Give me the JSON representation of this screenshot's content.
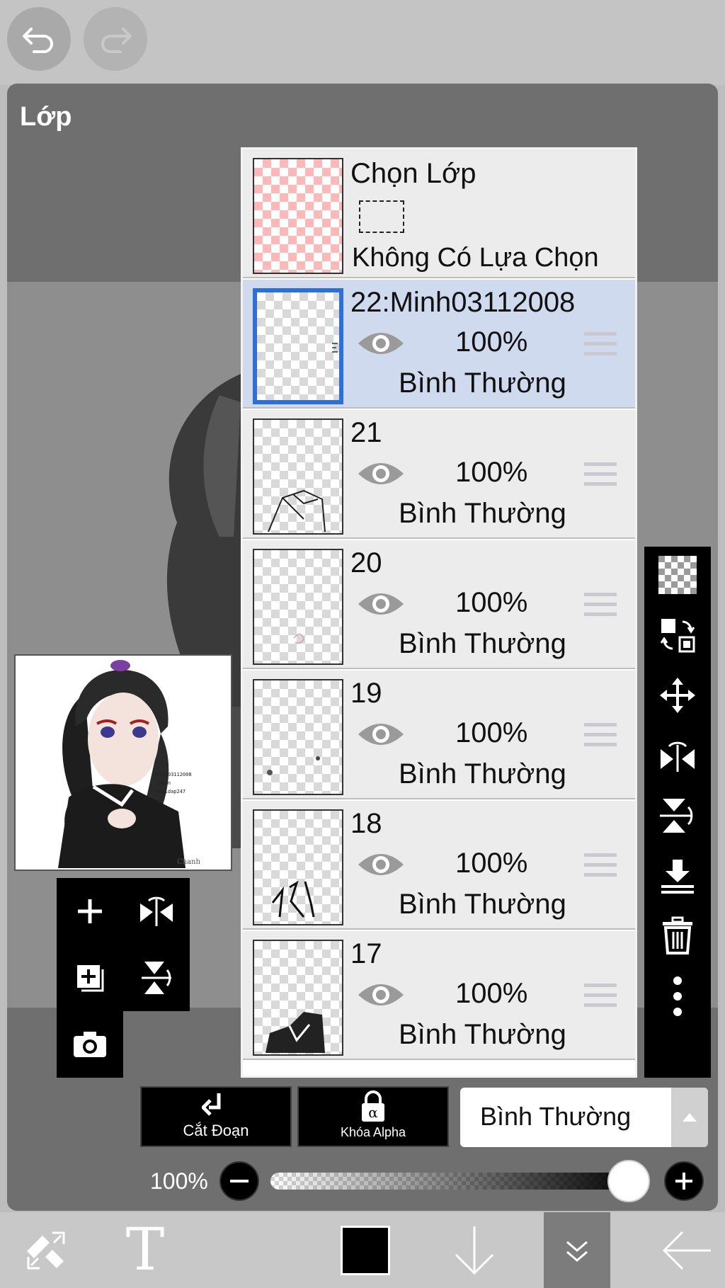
{
  "panel": {
    "title": "Lớp"
  },
  "selection_layer": {
    "title": "Chọn Lớp",
    "status": "Không Có Lựa Chọn"
  },
  "layers": [
    {
      "name": "22:Minh03112008",
      "opacity": "100%",
      "blend": "Bình Thường",
      "selected": true
    },
    {
      "name": "21",
      "opacity": "100%",
      "blend": "Bình Thường",
      "selected": false
    },
    {
      "name": "20",
      "opacity": "100%",
      "blend": "Bình Thường",
      "selected": false
    },
    {
      "name": "19",
      "opacity": "100%",
      "blend": "Bình Thường",
      "selected": false
    },
    {
      "name": "18",
      "opacity": "100%",
      "blend": "Bình Thường",
      "selected": false
    },
    {
      "name": "17",
      "opacity": "100%",
      "blend": "Bình Thường",
      "selected": false
    }
  ],
  "controls": {
    "clipping_label": "Cắt Đoạn",
    "alpha_lock_label": "Khóa Alpha",
    "blend_mode": "Bình Thường",
    "opacity_label": "100%",
    "opacity_value": 1.0
  },
  "preview": {
    "signature": "Chanh"
  },
  "colors": {
    "selected_row": "#cfdaee",
    "selected_border": "#2d6fd9",
    "current_color": "#000000"
  },
  "icons": {
    "top": [
      "undo-icon",
      "redo-icon"
    ],
    "left_tools": [
      "add-layer-icon",
      "flip-horizontal-icon",
      "duplicate-layer-icon",
      "flip-vertical-icon",
      "camera-icon"
    ],
    "right_tools": [
      "checker-icon",
      "swap-layer-icon",
      "move-icon",
      "flip-horizontal-icon",
      "flip-vertical-icon",
      "merge-down-icon",
      "trash-icon",
      "more-icon"
    ],
    "bottom": [
      "transform-icon",
      "text-icon",
      "color-swatch",
      "arrow-down-icon",
      "layers-collapse-icon",
      "back-arrow-icon"
    ]
  }
}
